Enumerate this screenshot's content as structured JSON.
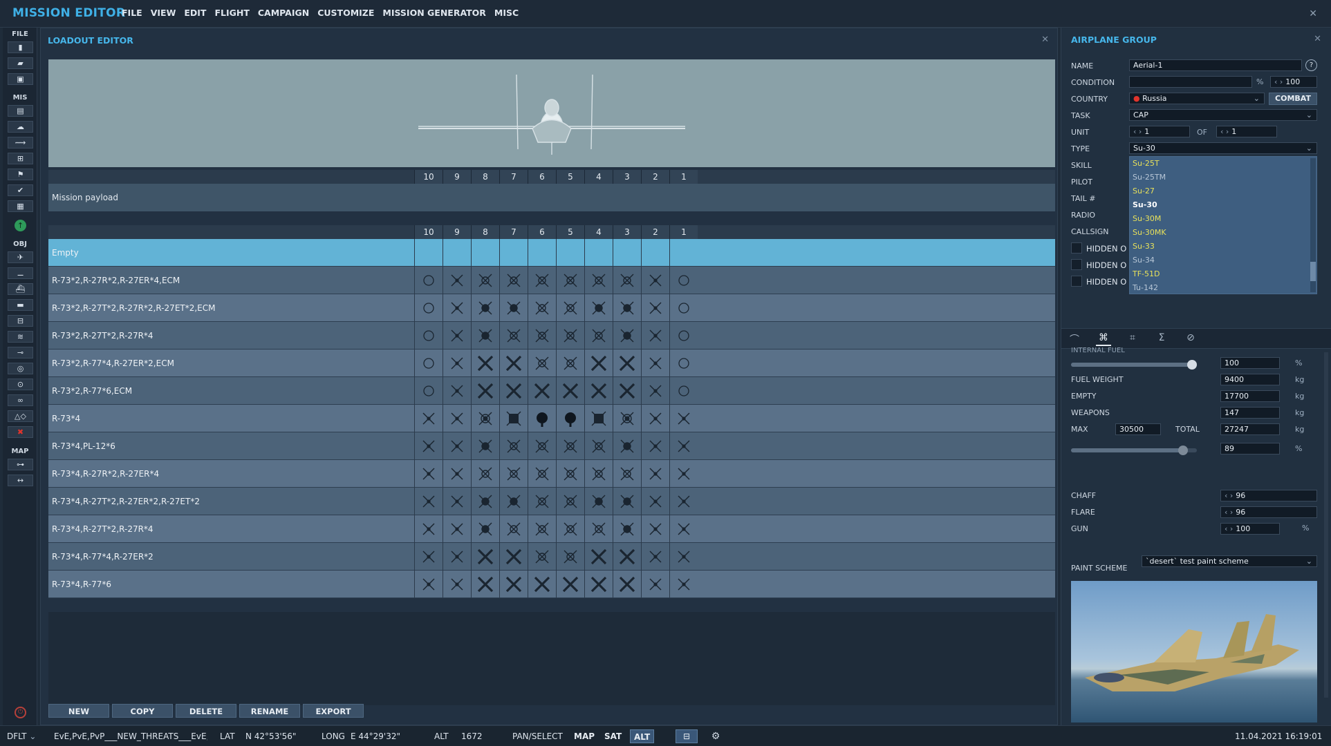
{
  "app": {
    "title": "MISSION EDITOR"
  },
  "menu": [
    "FILE",
    "VIEW",
    "EDIT",
    "FLIGHT",
    "CAMPAIGN",
    "CUSTOMIZE",
    "MISSION GENERATOR",
    "MISC"
  ],
  "toolbar": {
    "file_label": "FILE",
    "mis_label": "MIS",
    "obj_label": "OBJ",
    "map_label": "MAP"
  },
  "loadout": {
    "title": "LOADOUT EDITOR",
    "stations": [
      "10",
      "9",
      "8",
      "7",
      "6",
      "5",
      "4",
      "3",
      "2",
      "1"
    ],
    "mission_payload_label": "Mission payload",
    "selected_row": "Empty",
    "rows": [
      {
        "label": "R-73*2,R-27R*2,R-27ER*4,ECM",
        "icons": [
          "pod",
          "x",
          "quad",
          "quad",
          "quad",
          "quad",
          "quad",
          "quad",
          "x",
          "pod"
        ]
      },
      {
        "label": "R-73*2,R-27T*2,R-27R*2,R-27ET*2,ECM",
        "icons": [
          "pod",
          "x",
          "quadd",
          "quadd",
          "quad",
          "quad",
          "quadd",
          "quadd",
          "x",
          "pod"
        ]
      },
      {
        "label": "R-73*2,R-27T*2,R-27R*4",
        "icons": [
          "pod",
          "x",
          "quadd",
          "quad",
          "quad",
          "quad",
          "quad",
          "quadd",
          "x",
          "pod"
        ]
      },
      {
        "label": "R-73*2,R-77*4,R-27ER*2,ECM",
        "icons": [
          "pod",
          "x",
          "bigx",
          "bigx",
          "quad",
          "quad",
          "bigx",
          "bigx",
          "x",
          "pod"
        ]
      },
      {
        "label": "R-73*2,R-77*6,ECM",
        "icons": [
          "pod",
          "x",
          "bigx",
          "bigx",
          "bigx",
          "bigx",
          "bigx",
          "bigx",
          "x",
          "pod"
        ]
      },
      {
        "label": "R-73*4",
        "icons": [
          "x",
          "x",
          "bomb",
          "sq",
          "ball",
          "ball",
          "sq",
          "bomb",
          "x",
          "x"
        ]
      },
      {
        "label": "R-73*4,PL-12*6",
        "icons": [
          "x",
          "x",
          "quadd",
          "quad",
          "quad",
          "quad",
          "quad",
          "quadd",
          "x",
          "x"
        ]
      },
      {
        "label": "R-73*4,R-27R*2,R-27ER*4",
        "icons": [
          "x",
          "x",
          "quad",
          "quad",
          "quad",
          "quad",
          "quad",
          "quad",
          "x",
          "x"
        ]
      },
      {
        "label": "R-73*4,R-27T*2,R-27ER*2,R-27ET*2",
        "icons": [
          "x",
          "x",
          "quadd",
          "quadd",
          "quad",
          "quad",
          "quadd",
          "quadd",
          "x",
          "x"
        ]
      },
      {
        "label": "R-73*4,R-27T*2,R-27R*4",
        "icons": [
          "x",
          "x",
          "quadd",
          "quad",
          "quad",
          "quad",
          "quad",
          "quadd",
          "x",
          "x"
        ]
      },
      {
        "label": "R-73*4,R-77*4,R-27ER*2",
        "icons": [
          "x",
          "x",
          "bigx",
          "bigx",
          "quad",
          "quad",
          "bigx",
          "bigx",
          "x",
          "x"
        ]
      },
      {
        "label": "R-73*4,R-77*6",
        "icons": [
          "x",
          "x",
          "bigx",
          "bigx",
          "bigx",
          "bigx",
          "bigx",
          "bigx",
          "x",
          "x"
        ]
      }
    ],
    "buttons": {
      "new": "NEW",
      "copy": "COPY",
      "delete": "DELETE",
      "rename": "RENAME",
      "export": "EXPORT"
    }
  },
  "group": {
    "title": "AIRPLANE GROUP",
    "labels": {
      "name": "NAME",
      "condition": "CONDITION",
      "country": "COUNTRY",
      "task": "TASK",
      "unit": "UNIT",
      "type": "TYPE",
      "skill": "SKILL",
      "pilot": "PILOT",
      "tail": "TAIL #",
      "radio": "RADIO",
      "callsign": "CALLSIGN"
    },
    "name": "Aerial-1",
    "help": "?",
    "condition_unit": "%",
    "condition_value": "100",
    "country": "Russia",
    "combat_button": "COMBAT",
    "task": "CAP",
    "unit_value": "1",
    "unit_of": "OF",
    "unit_total": "1",
    "type": "Su-30",
    "type_options": [
      {
        "name": "Su-25T",
        "color": "#e8e15a"
      },
      {
        "name": "Su-25TM",
        "color": "#b7c6d6"
      },
      {
        "name": "Su-27",
        "color": "#e8e15a"
      },
      {
        "name": "Su-30",
        "color": "#ffffff"
      },
      {
        "name": "Su-30M",
        "color": "#e8e15a"
      },
      {
        "name": "Su-30MK",
        "color": "#e8e15a"
      },
      {
        "name": "Su-33",
        "color": "#e8e15a"
      },
      {
        "name": "Su-34",
        "color": "#b7c6d6"
      },
      {
        "name": "TF-51D",
        "color": "#e8e15a"
      },
      {
        "name": "Tu-142",
        "color": "#b7c6d6"
      }
    ],
    "hidden_label": "HIDDEN O",
    "fuel": {
      "internal_label": "INTERNAL FUEL",
      "internal_value": "100",
      "internal_fraction": 1.0,
      "pct": "%",
      "fuel_weight_label": "FUEL WEIGHT",
      "fuel_weight": "9400",
      "empty_label": "EMPTY",
      "empty": "17700",
      "weapons_label": "WEAPONS",
      "weapons": "147",
      "max_label": "MAX",
      "max": "30500",
      "total_label": "TOTAL",
      "total": "27247",
      "kg": "kg",
      "load_pct": "89",
      "load_fraction": 0.89
    },
    "countermeasures": {
      "chaff_label": "CHAFF",
      "chaff": "96",
      "flare_label": "FLARE",
      "flare": "96",
      "gun_label": "GUN",
      "gun": "100"
    },
    "paint_label": "PAINT SCHEME",
    "paint_value": "`desert` test paint scheme"
  },
  "status": {
    "mode": "DFLT",
    "coalitions": "EvE,PvE,PvP___NEW_THREATS___EvE,P",
    "lat_label": "LAT",
    "lat": "N 42°53'56\"",
    "long_label": "LONG",
    "long": "E 44°29'32\"",
    "alt_label": "ALT",
    "alt": "1672",
    "pan": "PAN/SELECT",
    "map": "MAP",
    "sat": "SAT",
    "alt_btn": "ALT",
    "datetime": "11.04.2021 16:19:01"
  },
  "colors": {
    "accent": "#46b6ea",
    "selected_row": "#62b3d6",
    "row_a": "#4c6379",
    "row_b": "#5a7189"
  }
}
